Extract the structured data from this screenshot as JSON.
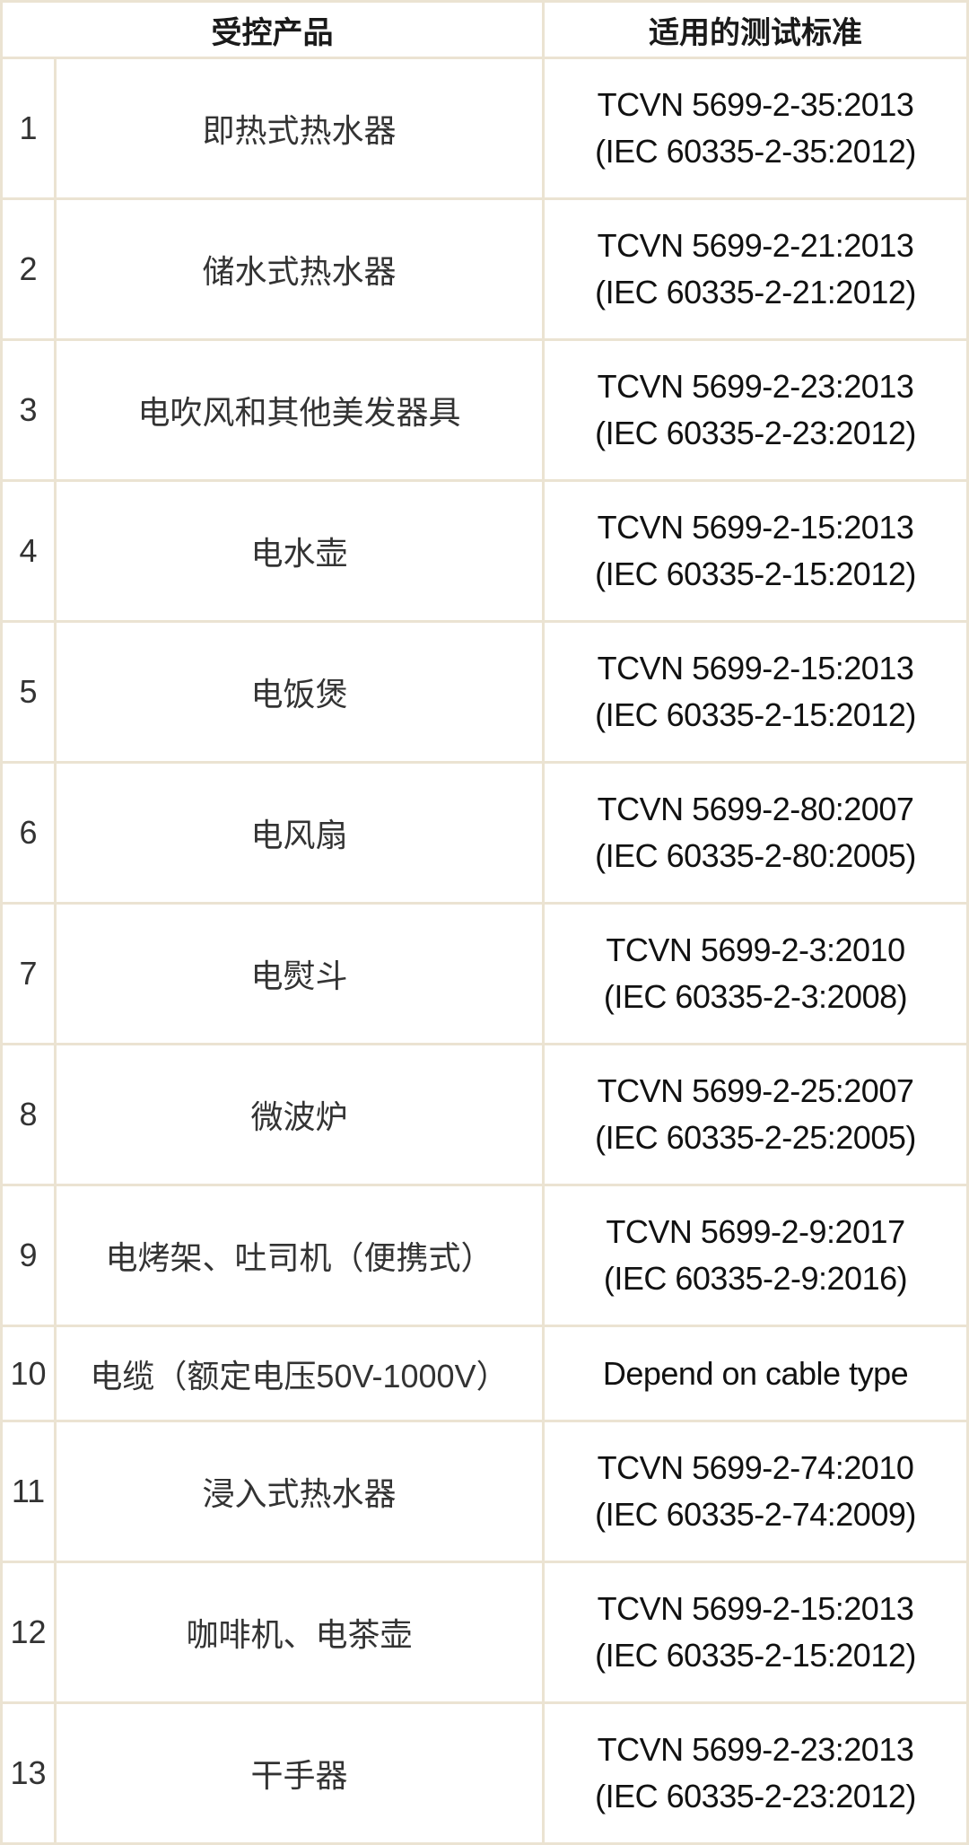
{
  "table": {
    "headers": {
      "product": "受控产品",
      "standard": "适用的测试标准"
    },
    "rows": [
      {
        "no": "1",
        "product": "即热式热水器",
        "std_line1": "TCVN 5699-2-35:2013",
        "std_line2": "(IEC 60335-2-35:2012)"
      },
      {
        "no": "2",
        "product": "储水式热水器",
        "std_line1": "TCVN 5699-2-21:2013",
        "std_line2": "(IEC 60335-2-21:2012)"
      },
      {
        "no": "3",
        "product": "电吹风和其他美发器具",
        "std_line1": "TCVN 5699-2-23:2013",
        "std_line2": "(IEC 60335-2-23:2012)"
      },
      {
        "no": "4",
        "product": "电水壶",
        "std_line1": "TCVN 5699-2-15:2013",
        "std_line2": "(IEC 60335-2-15:2012)"
      },
      {
        "no": "5",
        "product": "电饭煲",
        "std_line1": "TCVN 5699-2-15:2013",
        "std_line2": "(IEC 60335-2-15:2012)"
      },
      {
        "no": "6",
        "product": "电风扇",
        "std_line1": "TCVN 5699-2-80:2007",
        "std_line2": "(IEC 60335-2-80:2005)"
      },
      {
        "no": "7",
        "product": "电熨斗",
        "std_line1": "TCVN 5699-2-3:2010",
        "std_line2": "(IEC 60335-2-3:2008)"
      },
      {
        "no": "8",
        "product": "微波炉",
        "std_line1": "TCVN 5699-2-25:2007",
        "std_line2": "(IEC 60335-2-25:2005)"
      },
      {
        "no": "9",
        "product": "电烤架、吐司机（便携式）",
        "std_line1": "TCVN 5699-2-9:2017",
        "std_line2": "(IEC 60335-2-9:2016)"
      },
      {
        "no": "10",
        "product": "电缆（额定电压50V-1000V）",
        "std_line1": "Depend on cable type",
        "std_line2": ""
      },
      {
        "no": "11",
        "product": "浸入式热水器",
        "std_line1": "TCVN 5699-2-74:2010",
        "std_line2": "(IEC 60335-2-74:2009)"
      },
      {
        "no": "12",
        "product": "咖啡机、电茶壶",
        "std_line1": "TCVN 5699-2-15:2013",
        "std_line2": "(IEC 60335-2-15:2012)"
      },
      {
        "no": "13",
        "product": "干手器",
        "std_line1": "TCVN 5699-2-23:2013",
        "std_line2": "(IEC 60335-2-23:2012)"
      }
    ]
  },
  "colors": {
    "border": "#ebe3d2",
    "text": "#222222",
    "background": "#ffffff"
  }
}
